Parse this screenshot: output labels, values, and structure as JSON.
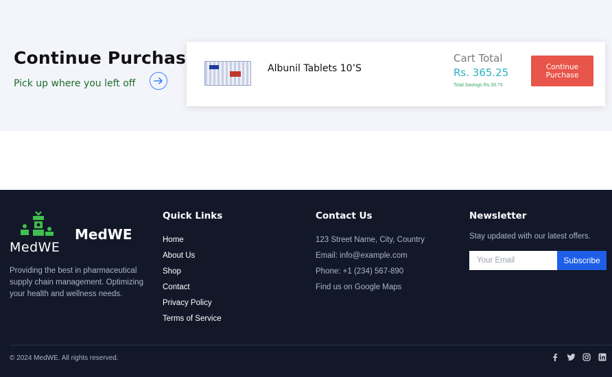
{
  "continue_purchase": {
    "title": "Continue Purchase",
    "subtitle": "Pick up where you left off",
    "product_name": "Albunil Tablets 10’S",
    "cart_total_label": "Cart Total",
    "cart_total_amount": "Rs. 365.25",
    "total_savings": "Total Savings Rs.39.75",
    "continue_button": "Continue\nPurchase"
  },
  "footer": {
    "logo_text": "MedWE",
    "brand": "MedWE",
    "about": "Providing the best in pharmaceutical supply chain management. Optimizing your health and wellness needs.",
    "quick_links": {
      "title": "Quick Links",
      "items": [
        "Home",
        "About Us",
        "Shop",
        "Contact",
        "Privacy Policy",
        "Terms of Service"
      ]
    },
    "contact": {
      "title": "Contact Us",
      "address": "123 Street Name, City, Country",
      "email": "Email: info@example.com",
      "phone": "Phone: +1 (234) 567-890",
      "map": "Find us on Google Maps"
    },
    "newsletter": {
      "title": "Newsletter",
      "text": "Stay updated with our latest offers.",
      "email_placeholder": "Your Email",
      "subscribe": "Subscribe"
    },
    "copyright": "© 2024 MedWE. All rights reserved.",
    "socials": [
      "facebook-icon",
      "twitter-icon",
      "instagram-icon",
      "linkedin-icon"
    ]
  },
  "colors": {
    "accent_red": "#e8554a",
    "accent_teal": "#2bb3c0",
    "subtitle_green": "#1b6e2c",
    "footer_bg": "#121828",
    "subscribe_blue": "#1f5fe8",
    "logo_green": "#3fbf4f"
  }
}
